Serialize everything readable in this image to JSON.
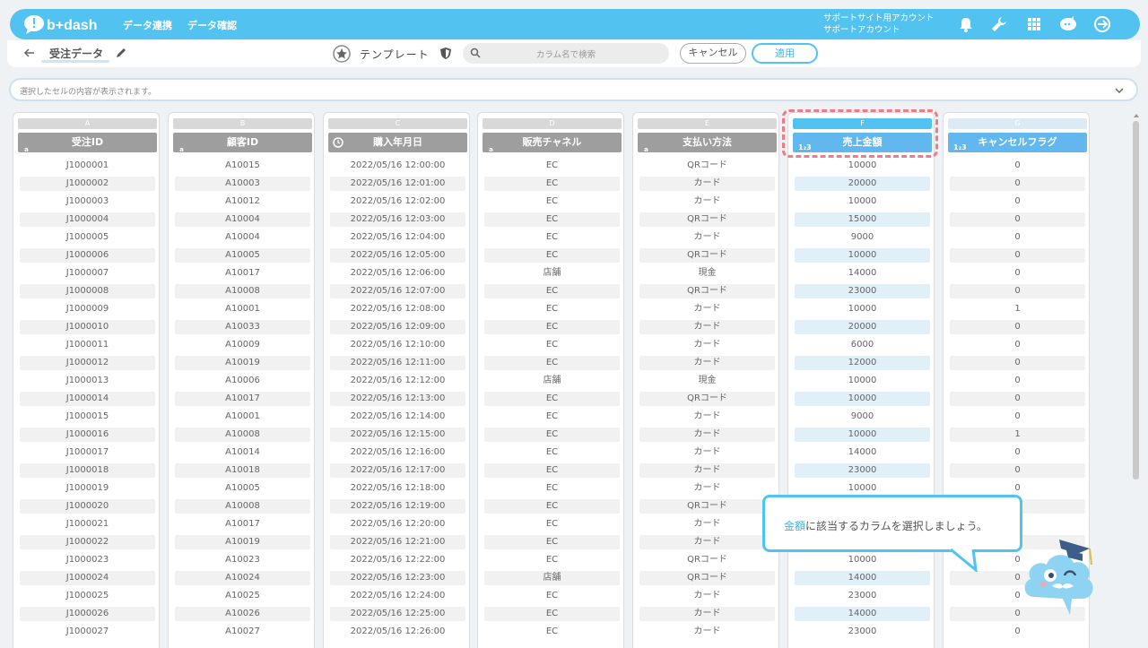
{
  "header": {
    "logo_text": "b+dash",
    "nav": [
      "データ連携",
      "データ確認"
    ],
    "account_line1": "サポートサイト用アカウント",
    "account_line2": "サポートアカウント",
    "icons": [
      "bell-icon",
      "wrench-icon",
      "grid-icon",
      "chat-icon",
      "logout-icon"
    ],
    "accent": "#52c3f0"
  },
  "toolbar": {
    "title": "受注データ",
    "template_label": "テンプレート",
    "search_placeholder": "カラム名で検索",
    "cancel_label": "キャンセル",
    "apply_label": "適用"
  },
  "preview": {
    "placeholder": "選択したセルの内容が表示されます。"
  },
  "columns": [
    {
      "letter": "A",
      "name": "受注ID",
      "type": "text",
      "style": ""
    },
    {
      "letter": "B",
      "name": "顧客ID",
      "type": "text",
      "style": ""
    },
    {
      "letter": "C",
      "name": "購入年月日",
      "type": "datetime",
      "style": ""
    },
    {
      "letter": "D",
      "name": "販売チャネル",
      "type": "text",
      "style": ""
    },
    {
      "letter": "E",
      "name": "支払い方法",
      "type": "text",
      "style": ""
    },
    {
      "letter": "F",
      "name": "売上金額",
      "type": "number",
      "style": "sel-col"
    },
    {
      "letter": "G",
      "name": "キャンセルフラグ",
      "type": "number",
      "style": "cancel-col"
    }
  ],
  "rows": [
    [
      "J1000001",
      "A10015",
      "2022/05/16 12:00:00",
      "EC",
      "QRコード",
      "10000",
      "0"
    ],
    [
      "J1000002",
      "A10003",
      "2022/05/16 12:01:00",
      "EC",
      "カード",
      "20000",
      "0"
    ],
    [
      "J1000003",
      "A10012",
      "2022/05/16 12:02:00",
      "EC",
      "カード",
      "10000",
      "0"
    ],
    [
      "J1000004",
      "A10004",
      "2022/05/16 12:03:00",
      "EC",
      "QRコード",
      "15000",
      "0"
    ],
    [
      "J1000005",
      "A10004",
      "2022/05/16 12:04:00",
      "EC",
      "カード",
      "9000",
      "0"
    ],
    [
      "J1000006",
      "A10005",
      "2022/05/16 12:05:00",
      "EC",
      "QRコード",
      "10000",
      "0"
    ],
    [
      "J1000007",
      "A10017",
      "2022/05/16 12:06:00",
      "店舗",
      "現金",
      "14000",
      "0"
    ],
    [
      "J1000008",
      "A10008",
      "2022/05/16 12:07:00",
      "EC",
      "QRコード",
      "23000",
      "0"
    ],
    [
      "J1000009",
      "A10001",
      "2022/05/16 12:08:00",
      "EC",
      "カード",
      "10000",
      "1"
    ],
    [
      "J1000010",
      "A10033",
      "2022/05/16 12:09:00",
      "EC",
      "カード",
      "20000",
      "0"
    ],
    [
      "J1000011",
      "A10009",
      "2022/05/16 12:10:00",
      "EC",
      "カード",
      "6000",
      "0"
    ],
    [
      "J1000012",
      "A10019",
      "2022/05/16 12:11:00",
      "EC",
      "カード",
      "12000",
      "0"
    ],
    [
      "J1000013",
      "A10006",
      "2022/05/16 12:12:00",
      "店舗",
      "現金",
      "10000",
      "0"
    ],
    [
      "J1000014",
      "A10017",
      "2022/05/16 12:13:00",
      "EC",
      "QRコード",
      "10000",
      "0"
    ],
    [
      "J1000015",
      "A10001",
      "2022/05/16 12:14:00",
      "EC",
      "カード",
      "9000",
      "0"
    ],
    [
      "J1000016",
      "A10008",
      "2022/05/16 12:15:00",
      "EC",
      "カード",
      "10000",
      "1"
    ],
    [
      "J1000017",
      "A10014",
      "2022/05/16 12:16:00",
      "EC",
      "カード",
      "14000",
      "0"
    ],
    [
      "J1000018",
      "A10018",
      "2022/05/16 12:17:00",
      "EC",
      "カード",
      "23000",
      "0"
    ],
    [
      "J1000019",
      "A10005",
      "2022/05/16 12:18:00",
      "EC",
      "カード",
      "10000",
      "0"
    ],
    [
      "J1000020",
      "A10008",
      "2022/05/16 12:19:00",
      "EC",
      "QRコード",
      "",
      ""
    ],
    [
      "J1000021",
      "A10017",
      "2022/05/16 12:20:00",
      "EC",
      "カード",
      "",
      ""
    ],
    [
      "J1000022",
      "A10019",
      "2022/05/16 12:21:00",
      "EC",
      "カード",
      "",
      ""
    ],
    [
      "J1000023",
      "A10023",
      "2022/05/16 12:22:00",
      "EC",
      "QRコード",
      "10000",
      "0"
    ],
    [
      "J1000024",
      "A10024",
      "2022/05/16 12:23:00",
      "店舗",
      "QRコード",
      "14000",
      "0"
    ],
    [
      "J1000025",
      "A10025",
      "2022/05/16 12:24:00",
      "EC",
      "カード",
      "23000",
      "0"
    ],
    [
      "J1000026",
      "A10026",
      "2022/05/16 12:25:00",
      "EC",
      "カード",
      "14000",
      "0"
    ],
    [
      "J1000027",
      "A10027",
      "2022/05/16 12:26:00",
      "EC",
      "カード",
      "23000",
      "0"
    ]
  ],
  "tooltip": {
    "keyword": "金額",
    "message": "に該当するカラムを選択しましょう。"
  }
}
